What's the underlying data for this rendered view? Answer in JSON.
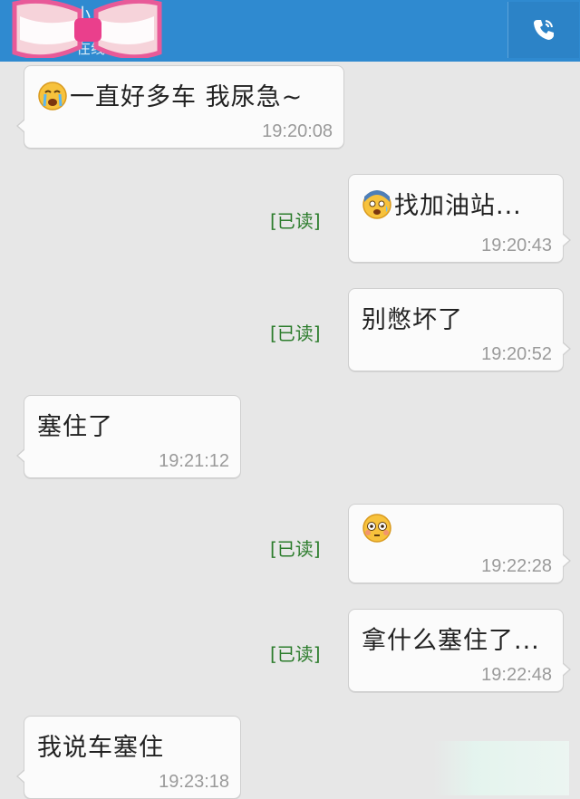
{
  "header": {
    "contact_name": "小",
    "contact_status": "在线",
    "call_icon": "phone-icon"
  },
  "messages": [
    {
      "side": "left",
      "emoji": "crying-emoji",
      "text": "一直好多车  我尿急~",
      "time": "19:20:08"
    },
    {
      "side": "right",
      "emoji": "anxious-emoji",
      "text": "找加油站...",
      "time": "19:20:43",
      "status": "[已读]"
    },
    {
      "side": "right",
      "emoji": "",
      "text": "别憋坏了",
      "time": "19:20:52",
      "status": "[已读]"
    },
    {
      "side": "left",
      "emoji": "",
      "text": "塞住了",
      "time": "19:21:12"
    },
    {
      "side": "right",
      "emoji": "flushed-emoji",
      "text": "",
      "time": "19:22:28",
      "status": "[已读]"
    },
    {
      "side": "right",
      "emoji": "",
      "text": "拿什么塞住了...",
      "time": "19:22:48",
      "status": "[已读]"
    },
    {
      "side": "left",
      "emoji": "",
      "text": "我说车塞住",
      "time": "19:23:18"
    }
  ],
  "colors": {
    "header_bg": "#2f8ad0",
    "chat_bg": "#e7e7e7",
    "bubble_bg": "#fbfbfb",
    "read_status": "#2d7d2d",
    "time_text": "#9a9a9a"
  }
}
